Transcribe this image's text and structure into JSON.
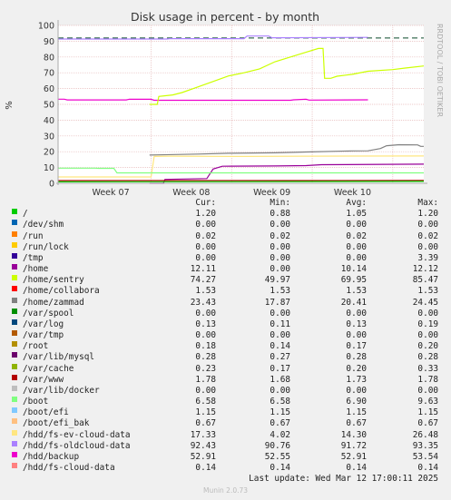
{
  "chart_data": {
    "type": "line",
    "title": "Disk usage in percent - by month",
    "ylabel": "%",
    "side_label": "RRDTOOL / TOBI OETIKER",
    "ylim": [
      0,
      100
    ],
    "yticks": [
      0,
      10,
      20,
      30,
      40,
      50,
      60,
      70,
      80,
      90,
      100
    ],
    "x_ticks": [
      "Week 07",
      "Week 08",
      "Week 09",
      "Week 10"
    ],
    "grid": true,
    "warning_level": 92,
    "legend_header": {
      "cur": "Cur:",
      "min": "Min:",
      "avg": "Avg:",
      "max": "Max:"
    },
    "series": [
      {
        "name": "/",
        "color": "#00cc00",
        "cur": "1.20",
        "min": "0.88",
        "avg": "1.05",
        "max": "1.20"
      },
      {
        "name": "/dev/shm",
        "color": "#0066b3",
        "cur": "0.00",
        "min": "0.00",
        "avg": "0.00",
        "max": "0.00"
      },
      {
        "name": "/run",
        "color": "#ff8000",
        "cur": "0.02",
        "min": "0.02",
        "avg": "0.02",
        "max": "0.02"
      },
      {
        "name": "/run/lock",
        "color": "#ffcc00",
        "cur": "0.00",
        "min": "0.00",
        "avg": "0.00",
        "max": "0.00"
      },
      {
        "name": "/tmp",
        "color": "#330099",
        "cur": "0.00",
        "min": "0.00",
        "avg": "0.00",
        "max": "3.39"
      },
      {
        "name": "/home",
        "color": "#990099",
        "cur": "12.11",
        "min": "0.00",
        "avg": "10.14",
        "max": "12.12"
      },
      {
        "name": "/home/sentry",
        "color": "#ccff00",
        "cur": "74.27",
        "min": "49.97",
        "avg": "69.95",
        "max": "85.47"
      },
      {
        "name": "/home/collabora",
        "color": "#ff0000",
        "cur": "1.53",
        "min": "1.53",
        "avg": "1.53",
        "max": "1.53"
      },
      {
        "name": "/home/zammad",
        "color": "#808080",
        "cur": "23.43",
        "min": "17.87",
        "avg": "20.41",
        "max": "24.45"
      },
      {
        "name": "/var/spool",
        "color": "#008f00",
        "cur": "0.00",
        "min": "0.00",
        "avg": "0.00",
        "max": "0.00"
      },
      {
        "name": "/var/log",
        "color": "#00487d",
        "cur": "0.13",
        "min": "0.11",
        "avg": "0.13",
        "max": "0.19"
      },
      {
        "name": "/var/tmp",
        "color": "#b35a00",
        "cur": "0.00",
        "min": "0.00",
        "avg": "0.00",
        "max": "0.00"
      },
      {
        "name": "/root",
        "color": "#b38f00",
        "cur": "0.18",
        "min": "0.14",
        "avg": "0.17",
        "max": "0.20"
      },
      {
        "name": "/var/lib/mysql",
        "color": "#6b006b",
        "cur": "0.28",
        "min": "0.27",
        "avg": "0.28",
        "max": "0.28"
      },
      {
        "name": "/var/cache",
        "color": "#8fb300",
        "cur": "0.23",
        "min": "0.17",
        "avg": "0.20",
        "max": "0.33"
      },
      {
        "name": "/var/www",
        "color": "#b30000",
        "cur": "1.78",
        "min": "1.68",
        "avg": "1.73",
        "max": "1.78"
      },
      {
        "name": "/var/lib/docker",
        "color": "#bebebe",
        "cur": "0.00",
        "min": "0.00",
        "avg": "0.00",
        "max": "0.00"
      },
      {
        "name": "/boot",
        "color": "#80ff80",
        "cur": "6.58",
        "min": "6.58",
        "avg": "6.90",
        "max": "9.63"
      },
      {
        "name": "/boot/efi",
        "color": "#80c9ff",
        "cur": "1.15",
        "min": "1.15",
        "avg": "1.15",
        "max": "1.15"
      },
      {
        "name": "/boot/efi_bak",
        "color": "#ffc080",
        "cur": "0.67",
        "min": "0.67",
        "avg": "0.67",
        "max": "0.67"
      },
      {
        "name": "/hdd/fs-ev-cloud-data",
        "color": "#ffe680",
        "cur": "17.33",
        "min": "4.02",
        "avg": "14.30",
        "max": "26.48"
      },
      {
        "name": "/hdd/fs-oldcloud-data",
        "color": "#aa80ff",
        "cur": "92.43",
        "min": "90.76",
        "avg": "91.72",
        "max": "93.35"
      },
      {
        "name": "/hdd/backup",
        "color": "#ee00cc",
        "cur": "52.91",
        "min": "52.55",
        "avg": "52.91",
        "max": "53.54"
      },
      {
        "name": "/hdd/fs-cloud-data",
        "color": "#ff8080",
        "cur": "0.14",
        "min": "0.14",
        "avg": "0.14",
        "max": "0.14"
      }
    ],
    "paths": [
      {
        "name": "/hdd/fs-oldcloud-data",
        "color": "#aa80ff",
        "points": [
          [
            0,
            91.4
          ],
          [
            0.35,
            91.4
          ],
          [
            0.36,
            91.6
          ],
          [
            0.6,
            91.6
          ],
          [
            0.61,
            93.3
          ],
          [
            0.68,
            93.3
          ],
          [
            0.69,
            92.2
          ],
          [
            1,
            92.4
          ]
        ]
      },
      {
        "name": "/hdd/backup",
        "color": "#ee00cc",
        "points": [
          [
            0,
            53.3
          ],
          [
            0.02,
            53.3
          ],
          [
            0.03,
            52.8
          ],
          [
            0.22,
            52.8
          ],
          [
            0.23,
            53.3
          ],
          [
            0.3,
            53.2
          ],
          [
            0.31,
            52.6
          ],
          [
            0.75,
            52.6
          ],
          [
            0.76,
            52.9
          ],
          [
            0.8,
            53.2
          ],
          [
            0.81,
            52.7
          ],
          [
            1,
            52.9
          ]
        ]
      },
      {
        "name": "/home/sentry",
        "color": "#ccff00",
        "points": [
          [
            0.295,
            50
          ],
          [
            0.32,
            50
          ],
          [
            0.325,
            55
          ],
          [
            0.37,
            56
          ],
          [
            0.4,
            57.5
          ],
          [
            0.45,
            61
          ],
          [
            0.5,
            64.5
          ],
          [
            0.55,
            68
          ],
          [
            0.6,
            70
          ],
          [
            0.65,
            72.5
          ],
          [
            0.7,
            77
          ],
          [
            0.75,
            80
          ],
          [
            0.8,
            83
          ],
          [
            0.84,
            85.4
          ],
          [
            0.855,
            85.4
          ],
          [
            0.86,
            66.5
          ],
          [
            0.88,
            66.5
          ],
          [
            0.9,
            67.8
          ],
          [
            0.95,
            69
          ],
          [
            1,
            71
          ],
          [
            1.08,
            72
          ],
          [
            1.12,
            73
          ],
          [
            1.18,
            74.3
          ]
        ]
      },
      {
        "name": "/home/zammad",
        "color": "#808080",
        "points": [
          [
            0.295,
            17.9
          ],
          [
            0.32,
            18
          ],
          [
            0.45,
            18.5
          ],
          [
            0.55,
            19
          ],
          [
            0.7,
            19.3
          ],
          [
            0.8,
            19.8
          ],
          [
            0.95,
            20.5
          ],
          [
            1.0,
            20.6
          ],
          [
            1.04,
            22
          ],
          [
            1.06,
            23.8
          ],
          [
            1.1,
            24.4
          ],
          [
            1.16,
            24.3
          ],
          [
            1.17,
            23.4
          ],
          [
            1.18,
            23.4
          ]
        ]
      },
      {
        "name": "/hdd/fs-ev-cloud-data",
        "color": "#ffe680",
        "points": [
          [
            0,
            4
          ],
          [
            0.2,
            4
          ],
          [
            0.3,
            4
          ],
          [
            0.31,
            17
          ],
          [
            0.36,
            17.2
          ],
          [
            0.6,
            17
          ],
          [
            0.8,
            17.2
          ],
          [
            1.18,
            17.3
          ]
        ]
      },
      {
        "name": "/home",
        "color": "#990099",
        "points": [
          [
            0.295,
            0
          ],
          [
            0.34,
            0
          ],
          [
            0.345,
            2.5
          ],
          [
            0.48,
            3
          ],
          [
            0.5,
            9
          ],
          [
            0.53,
            10.8
          ],
          [
            0.7,
            11
          ],
          [
            0.8,
            11.2
          ],
          [
            0.85,
            11.8
          ],
          [
            1.18,
            12.1
          ]
        ]
      },
      {
        "name": "/boot",
        "color": "#80ff80",
        "points": [
          [
            0,
            9.6
          ],
          [
            0.12,
            9.6
          ],
          [
            0.13,
            9.5
          ],
          [
            0.18,
            9.5
          ],
          [
            0.19,
            6.6
          ],
          [
            1.18,
            6.6
          ]
        ]
      },
      {
        "name": "/var/www",
        "color": "#b30000",
        "points": [
          [
            0,
            1.7
          ],
          [
            1.18,
            1.78
          ]
        ]
      },
      {
        "name": "/",
        "color": "#00cc00",
        "points": [
          [
            0,
            0.9
          ],
          [
            1.18,
            1.2
          ]
        ]
      }
    ]
  },
  "footer": {
    "last_update": "Last update: Wed Mar 12 17:00:11 2025",
    "generator": "Munin 2.0.73"
  }
}
